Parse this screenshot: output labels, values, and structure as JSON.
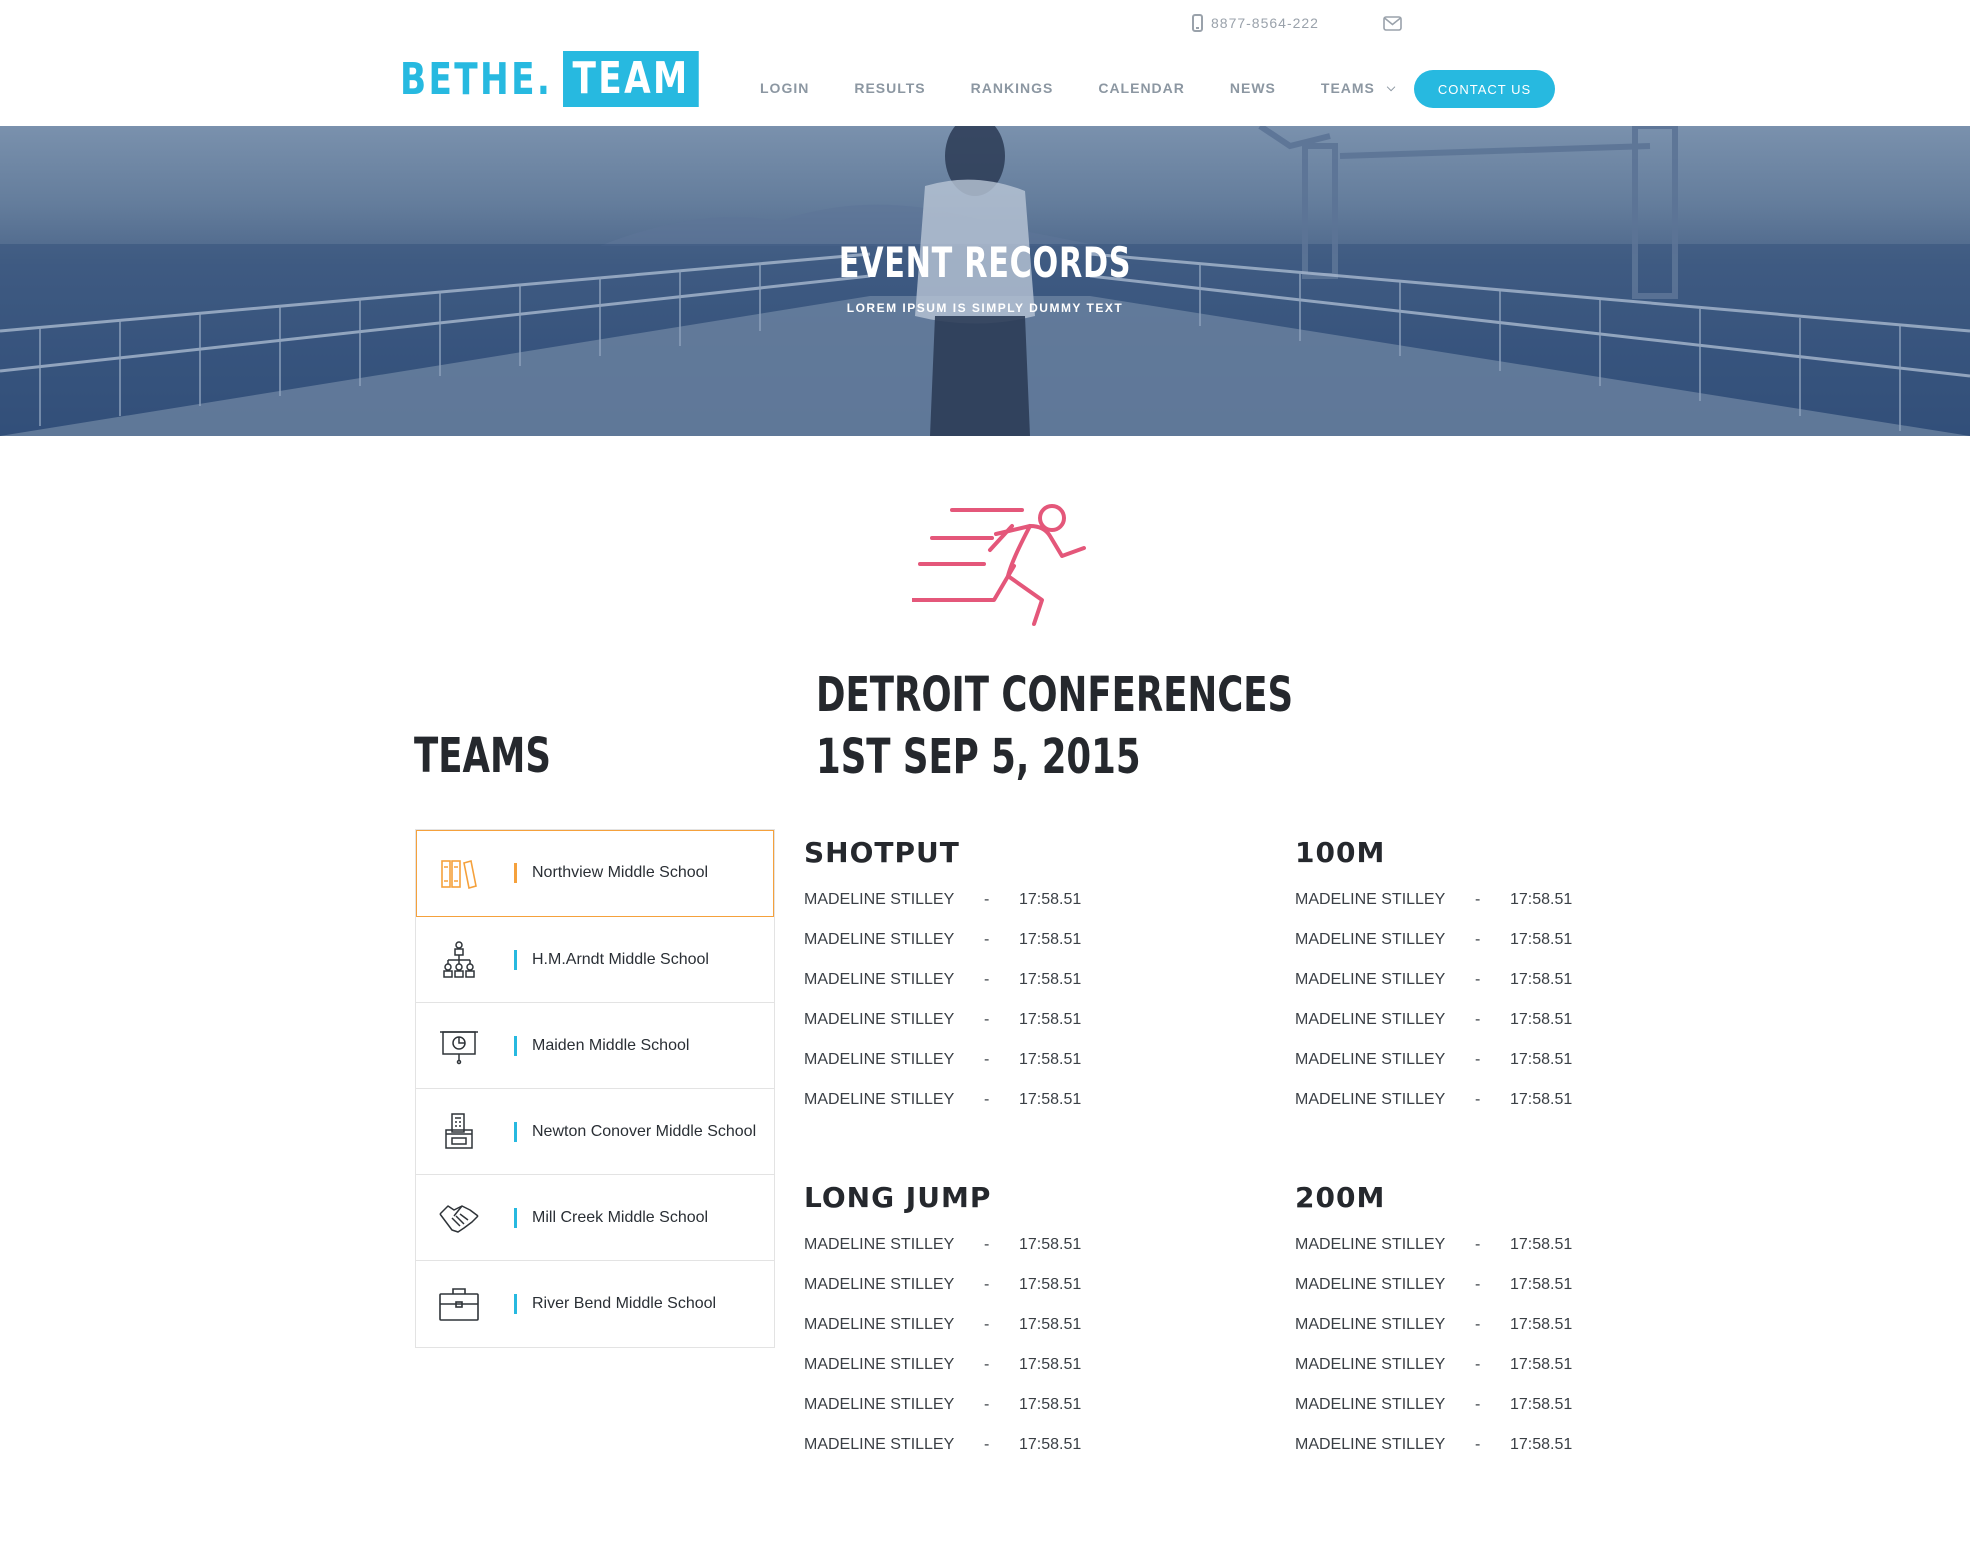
{
  "header": {
    "logo_left": "BETHE.",
    "logo_right": "TEAM",
    "phone": "8877-8564-222",
    "nav": [
      {
        "label": "LOGIN"
      },
      {
        "label": "RESULTS"
      },
      {
        "label": "RANKINGS"
      },
      {
        "label": "CALENDAR"
      },
      {
        "label": "NEWS"
      },
      {
        "label": "TEAMS"
      }
    ],
    "contact_button": "CONTACT US"
  },
  "hero": {
    "title": "EVENT RECORDS",
    "subtitle": "LOREM IPSUM IS SIMPLY DUMMY TEXT"
  },
  "event": {
    "line1": "DETROIT CONFERENCES",
    "line2": "1ST SEP 5, 2015"
  },
  "teams": {
    "heading": "TEAMS",
    "items": [
      {
        "name": "Northview Middle School",
        "icon": "books-icon"
      },
      {
        "name": "H.M.Arndt Middle School",
        "icon": "org-chart-icon"
      },
      {
        "name": "Maiden Middle School",
        "icon": "presentation-board-icon"
      },
      {
        "name": "Newton Conover Middle School",
        "icon": "desk-phone-icon"
      },
      {
        "name": "Mill Creek Middle School",
        "icon": "handshake-icon"
      },
      {
        "name": "River Bend Middle School",
        "icon": "briefcase-icon"
      }
    ]
  },
  "records": {
    "shotput": {
      "title": "SHOTPUT",
      "rows": [
        {
          "name": "MADELINE STILLEY",
          "dash": "-",
          "time": "17:58.51"
        },
        {
          "name": "MADELINE STILLEY",
          "dash": "-",
          "time": "17:58.51"
        },
        {
          "name": "MADELINE STILLEY",
          "dash": "-",
          "time": "17:58.51"
        },
        {
          "name": "MADELINE STILLEY",
          "dash": "-",
          "time": "17:58.51"
        },
        {
          "name": "MADELINE STILLEY",
          "dash": "-",
          "time": "17:58.51"
        },
        {
          "name": "MADELINE STILLEY",
          "dash": "-",
          "time": "17:58.51"
        }
      ]
    },
    "m100": {
      "title": "100M",
      "rows": [
        {
          "name": "MADELINE STILLEY",
          "dash": "-",
          "time": "17:58.51"
        },
        {
          "name": "MADELINE STILLEY",
          "dash": "-",
          "time": "17:58.51"
        },
        {
          "name": "MADELINE STILLEY",
          "dash": "-",
          "time": "17:58.51"
        },
        {
          "name": "MADELINE STILLEY",
          "dash": "-",
          "time": "17:58.51"
        },
        {
          "name": "MADELINE STILLEY",
          "dash": "-",
          "time": "17:58.51"
        },
        {
          "name": "MADELINE STILLEY",
          "dash": "-",
          "time": "17:58.51"
        }
      ]
    },
    "longjump": {
      "title": "LONG JUMP",
      "rows": [
        {
          "name": "MADELINE STILLEY",
          "dash": "-",
          "time": "17:58.51"
        },
        {
          "name": "MADELINE STILLEY",
          "dash": "-",
          "time": "17:58.51"
        },
        {
          "name": "MADELINE STILLEY",
          "dash": "-",
          "time": "17:58.51"
        },
        {
          "name": "MADELINE STILLEY",
          "dash": "-",
          "time": "17:58.51"
        },
        {
          "name": "MADELINE STILLEY",
          "dash": "-",
          "time": "17:58.51"
        },
        {
          "name": "MADELINE STILLEY",
          "dash": "-",
          "time": "17:58.51"
        }
      ]
    },
    "m200": {
      "title": "200M",
      "rows": [
        {
          "name": "MADELINE STILLEY",
          "dash": "-",
          "time": "17:58.51"
        },
        {
          "name": "MADELINE STILLEY",
          "dash": "-",
          "time": "17:58.51"
        },
        {
          "name": "MADELINE STILLEY",
          "dash": "-",
          "time": "17:58.51"
        },
        {
          "name": "MADELINE STILLEY",
          "dash": "-",
          "time": "17:58.51"
        },
        {
          "name": "MADELINE STILLEY",
          "dash": "-",
          "time": "17:58.51"
        },
        {
          "name": "MADELINE STILLEY",
          "dash": "-",
          "time": "17:58.51"
        }
      ]
    }
  },
  "colors": {
    "accent": "#27b9e0",
    "active_team": "#f5a13c",
    "runner_icon": "#e4577a",
    "nav_text": "#8c97a2"
  }
}
